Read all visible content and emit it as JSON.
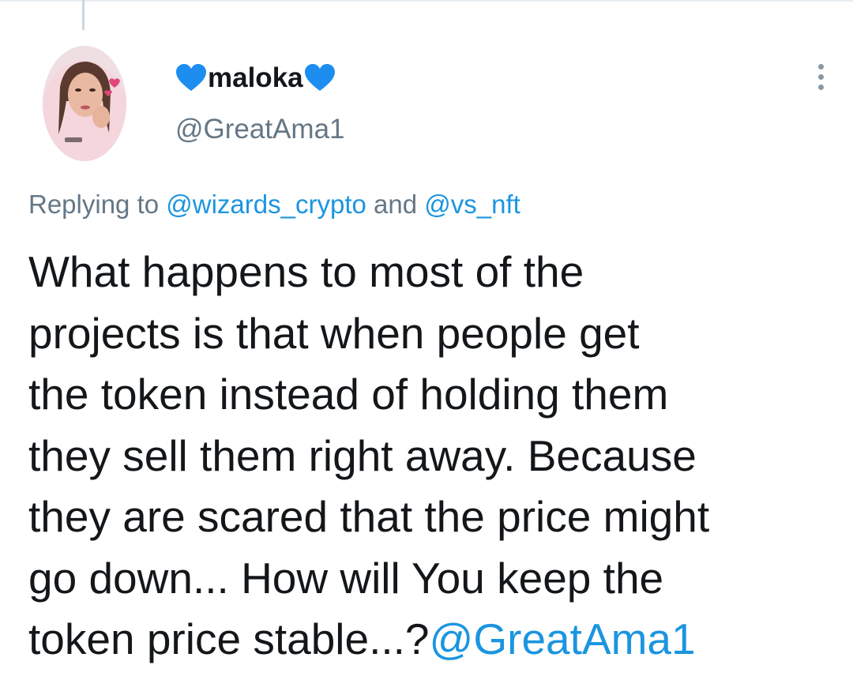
{
  "user": {
    "display_name": "maloka",
    "handle": "@GreatAma1",
    "name_icon": "blue-heart-icon",
    "avatar": "profile-photo-avatar"
  },
  "reply": {
    "prefix": "Replying to ",
    "mention1": "@wizards_crypto",
    "connector": " and ",
    "mention2": "@vs_nft"
  },
  "tweet": {
    "line1": "What happens to most of the",
    "line2": "projects is that when people get",
    "line3": "the token instead of holding them",
    "line4": "they sell them right away. Because",
    "line5": "they are scared that the price might",
    "line6": "go down... How will You keep the",
    "line7": "token price stable...?",
    "mention": "@GreatAma1"
  },
  "colors": {
    "text": "#14171a",
    "secondary": "#657786",
    "link": "#1b95e0",
    "heart": "#1d8ef0"
  },
  "icons": {
    "more": "more-vertical-icon"
  }
}
